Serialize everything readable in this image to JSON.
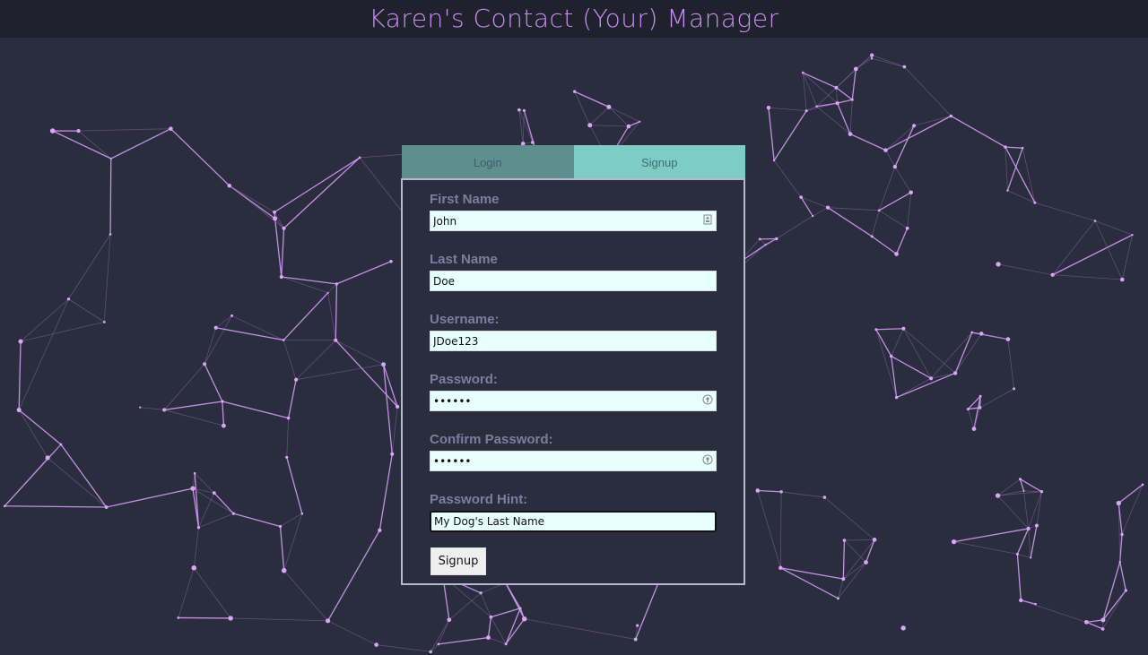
{
  "header": {
    "title": "Karen's Contact (Your) Manager"
  },
  "tabs": [
    {
      "label": "Login",
      "active": false
    },
    {
      "label": "Signup",
      "active": true
    }
  ],
  "form": {
    "first_name": {
      "label": "First Name",
      "value": "John"
    },
    "last_name": {
      "label": "Last Name",
      "value": "Doe"
    },
    "username": {
      "label": "Username:",
      "value": "JDoe123"
    },
    "password": {
      "label": "Password:",
      "value": "••••••"
    },
    "confirm_password": {
      "label": "Confirm Password:",
      "value": "••••••"
    },
    "password_hint": {
      "label": "Password Hint:",
      "value": "My Dog's Last Name"
    },
    "submit_label": "Signup"
  },
  "colors": {
    "accent": "#c98df0",
    "background": "#2a2d3d",
    "tab_active": "#7ecdc5",
    "tab_inactive": "#5f8e8e",
    "input_bg": "#e8ffff"
  }
}
